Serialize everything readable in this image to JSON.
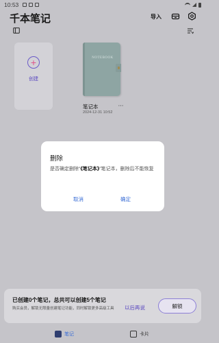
{
  "status_bar": {
    "time": "10:53"
  },
  "header": {
    "title": "千本笔记",
    "import_label": "导入"
  },
  "create": {
    "label": "创建"
  },
  "notebook": {
    "cover_text": "NOTEBOOK",
    "name": "笔记本",
    "date": "2024-12-31 10:52"
  },
  "dialog": {
    "title": "删除",
    "message_prefix": "是否确定删除“",
    "message_name": "《笔记本》",
    "message_suffix": "”笔记本，删除后不能恢复",
    "cancel_label": "取消",
    "confirm_label": "确定"
  },
  "banner": {
    "title": "已创建0个笔记，总共可以创建5个笔记",
    "description": "购买会员，解锁无限量创建笔记功能，同时解锁更多高级工具",
    "later_label": "以后再说",
    "unlock_label": "解锁"
  },
  "tabs": [
    {
      "label": "笔记",
      "icon": "notebook-tab-icon",
      "active": true
    },
    {
      "label": "卡片",
      "icon": "card-tab-icon",
      "active": false
    }
  ],
  "colors": {
    "accent": "#3c6fd6",
    "purple": "#5a48c0",
    "notebook_cover": "#8ea5a3",
    "overlay_bg": "#c5c4c9"
  }
}
